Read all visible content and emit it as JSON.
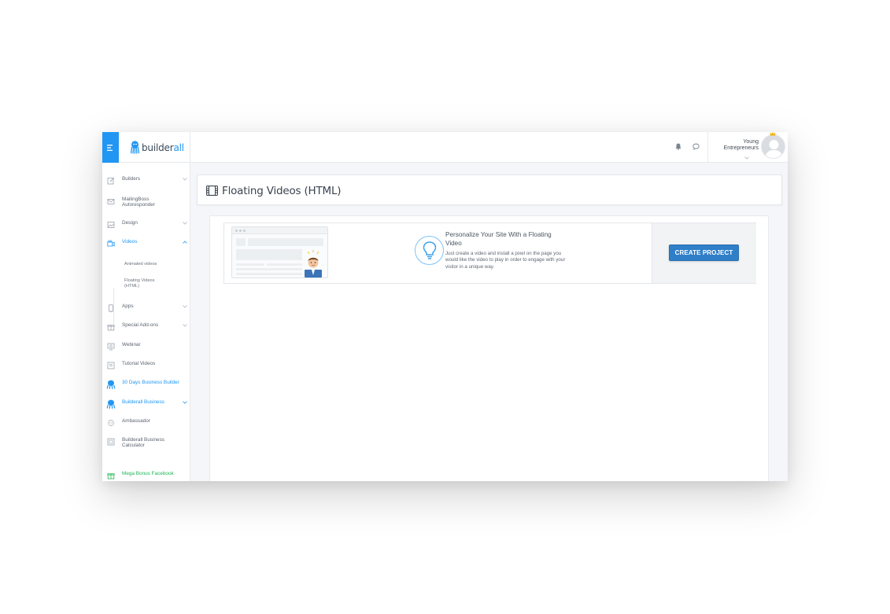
{
  "brand": {
    "name_part1": "builder",
    "name_part2": "all"
  },
  "header": {
    "user_name": "Young Entrepreneurs"
  },
  "sidebar": {
    "items": [
      {
        "label": "Builders",
        "icon": "pencil-icon",
        "caret": true
      },
      {
        "label": "MailingBoss Autoresponder",
        "icon": "envelope-icon",
        "caret": false
      },
      {
        "label": "Design",
        "icon": "image-icon",
        "caret": true
      },
      {
        "label": "Videos",
        "icon": "video-icon",
        "caret": true,
        "active": true
      },
      {
        "label": "Apps",
        "icon": "phone-icon",
        "caret": true
      },
      {
        "label": "Special Add-ons",
        "icon": "gift-icon",
        "caret": true
      },
      {
        "label": "Webinar",
        "icon": "webinar-icon",
        "caret": false
      },
      {
        "label": "Tutorial Videos",
        "icon": "tutorial-icon",
        "caret": false
      },
      {
        "label": "30 Days Business Builder",
        "icon": "octopus-icon",
        "caret": false
      },
      {
        "label": "Builderall Business",
        "icon": "octopus-icon",
        "caret": true
      },
      {
        "label": "Ambassador",
        "icon": "globe-icon",
        "caret": false
      },
      {
        "label": "Builderall Business Calculator",
        "icon": "calculator-icon",
        "caret": false
      },
      {
        "label": "Mega Bonus Facebook",
        "icon": "gift-icon",
        "caret": false
      }
    ],
    "sub_items": [
      "Animated videos",
      "Floating Videos (HTML)"
    ]
  },
  "page": {
    "title": "Floating Videos (HTML)"
  },
  "card": {
    "title": "Personalize Your Site With a Floating Video",
    "description": "Just create a video and install a pixel on the page you would like the video to play in order to engage with your visitor in a unique way.",
    "button_label": "CREATE PROJECT"
  },
  "colors": {
    "accent": "#2196f3",
    "button": "#2f7fc8",
    "bonus": "#20b554"
  }
}
